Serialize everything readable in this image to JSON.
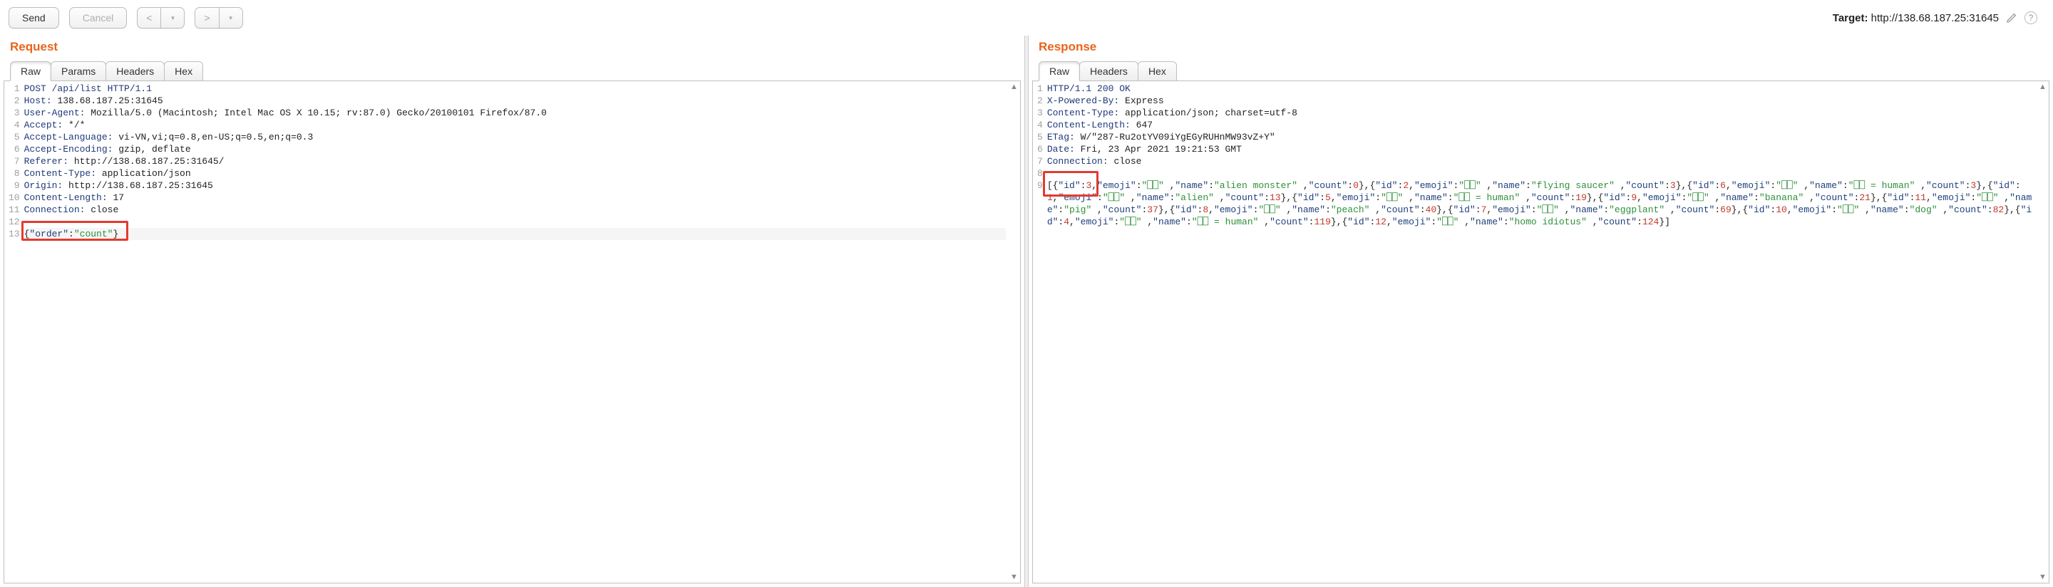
{
  "toolbar": {
    "send_label": "Send",
    "cancel_label": "Cancel"
  },
  "target": {
    "label": "Target:",
    "url": "http://138.68.187.25:31645"
  },
  "request": {
    "title": "Request",
    "tabs": [
      "Raw",
      "Params",
      "Headers",
      "Hex"
    ],
    "active_tab": "Raw",
    "lines": [
      "POST /api/list HTTP/1.1",
      "Host: 138.68.187.25:31645",
      "User-Agent: Mozilla/5.0 (Macintosh; Intel Mac OS X 10.15; rv:87.0) Gecko/20100101 Firefox/87.0",
      "Accept: */*",
      "Accept-Language: vi-VN,vi;q=0.8,en-US;q=0.5,en;q=0.3",
      "Accept-Encoding: gzip, deflate",
      "Referer: http://138.68.187.25:31645/",
      "Content-Type: application/json",
      "Origin: http://138.68.187.25:31645",
      "Content-Length: 17",
      "Connection: close",
      "",
      "{\"order\":\"count\"}"
    ],
    "highlighted_line_index": 12
  },
  "response": {
    "title": "Response",
    "tabs": [
      "Raw",
      "Headers",
      "Hex"
    ],
    "active_tab": "Raw",
    "header_lines": [
      "HTTP/1.1 200 OK",
      "X-Powered-By: Express",
      "Content-Type: application/json; charset=utf-8",
      "Content-Length: 647",
      "ETag: W/\"287-Ru2otYV09iYgEGyRUHnMW93vZ+Y\"",
      "Date: Fri, 23 Apr 2021 19:21:53 GMT",
      "Connection: close",
      ""
    ],
    "body_items": [
      {
        "id": 3,
        "emoji": "⎕⎕",
        "name": "alien monster",
        "count": 0
      },
      {
        "id": 2,
        "emoji": "⎕⎕",
        "name": "flying saucer",
        "count": 3
      },
      {
        "id": 6,
        "emoji": "⎕⎕",
        "name": "⎕⎕ = human",
        "count": 3
      },
      {
        "id": 1,
        "emoji": "⎕⎕",
        "name": "alien",
        "count": 13
      },
      {
        "id": 5,
        "emoji": "⎕⎕",
        "name": "⎕⎕ = human",
        "count": 19
      },
      {
        "id": 9,
        "emoji": "⎕⎕",
        "name": "banana",
        "count": 21
      },
      {
        "id": 11,
        "emoji": "⎕⎕",
        "name": "pig",
        "count": 37
      },
      {
        "id": 8,
        "emoji": "⎕⎕",
        "name": "peach",
        "count": 40
      },
      {
        "id": 7,
        "emoji": "⎕⎕",
        "name": "eggplant",
        "count": 69
      },
      {
        "id": 10,
        "emoji": "⎕⎕",
        "name": "dog",
        "count": 82
      },
      {
        "id": 4,
        "emoji": "⎕⎕",
        "name": "⎕⎕ = human",
        "count": 119
      },
      {
        "id": 12,
        "emoji": "⎕⎕",
        "name": "homo idiotus",
        "count": 124
      }
    ]
  }
}
